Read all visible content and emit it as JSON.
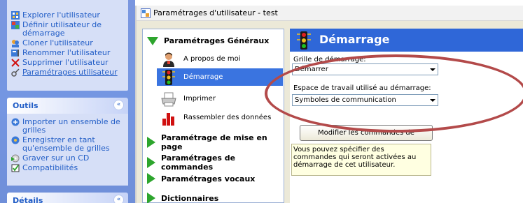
{
  "taskpane": {
    "user_items": [
      {
        "label": "Explorer l'utilisateur",
        "icon": "user-explore-icon"
      },
      {
        "label": "Définir utilisateur de démarrage",
        "icon": "startup-user-icon"
      },
      {
        "label": "Cloner l'utilisateur",
        "icon": "clone-user-icon"
      },
      {
        "label": "Renommer l'utilisateur",
        "icon": "rename-user-icon"
      },
      {
        "label": "Supprimer l'utilisateur",
        "icon": "delete-icon"
      },
      {
        "label": "Paramétrages utilisateur",
        "icon": "settings-icon"
      }
    ],
    "outils": {
      "title": "Outils",
      "items": [
        {
          "label": "Importer un ensemble de grilles",
          "icon": "import-icon"
        },
        {
          "label": "Enregistrer en tant qu'ensemble de grilles",
          "icon": "save-icon"
        },
        {
          "label": "Graver sur un CD",
          "icon": "burn-cd-icon"
        },
        {
          "label": "Compatibilités",
          "icon": "compat-icon"
        }
      ]
    },
    "details": {
      "title": "Détails"
    },
    "collapse_glyph": "«"
  },
  "window": {
    "title": "Paramétrages d'utilisateur - test"
  },
  "nav": {
    "general": {
      "label": "Paramétrages Généraux",
      "items": [
        {
          "label": "A propos de moi",
          "icon": "person-icon"
        },
        {
          "label": "Démarrage",
          "icon": "traffic-light-icon",
          "selected": true
        },
        {
          "label": "Imprimer",
          "icon": "printer-icon"
        },
        {
          "label": "Rassembler des données",
          "icon": "bar-chart-icon"
        }
      ]
    },
    "groups": [
      {
        "label": "Paramétrage de mise en page"
      },
      {
        "label": "Paramétrages de commandes"
      },
      {
        "label": "Paramétrages vocaux"
      },
      {
        "label": "Dictionnaires"
      }
    ]
  },
  "content": {
    "title": "Démarrage",
    "grille_label": "Grille de démarrage:",
    "grille_value": "Démarrer",
    "espace_label": "Espace de travail utilisé au démarrage:",
    "espace_value": "Symboles de communication",
    "modifier_button": "Modifier les commandes de démarrage",
    "note": "Vous pouvez spécifier des commandes qui seront activées au démarrage de cet utilisateur."
  },
  "colors": {
    "accent": "#2f67d8",
    "selection": "#3a74e0",
    "annotation": "#b34a4a",
    "link": "#215dc6"
  }
}
